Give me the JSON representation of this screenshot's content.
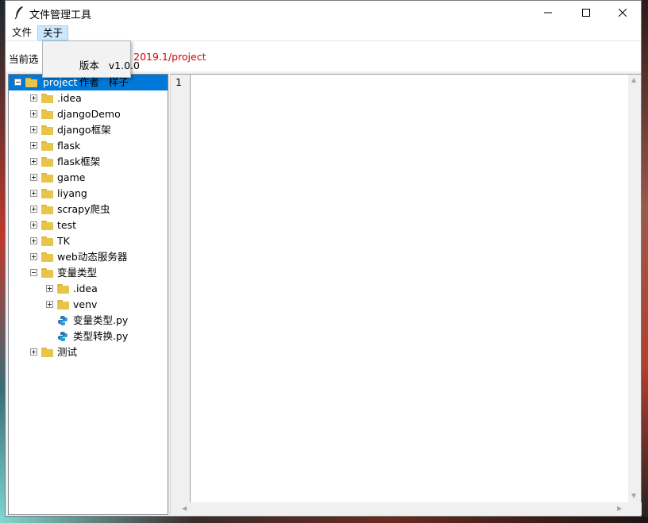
{
  "window": {
    "title": "文件管理工具",
    "icon": "feather-icon"
  },
  "menubar": {
    "items": [
      {
        "label": "文件"
      },
      {
        "label": "关于"
      }
    ]
  },
  "about_menu": {
    "rows": [
      {
        "label": "版本",
        "value": "v1.0.0"
      },
      {
        "label": "作者",
        "value": "样子"
      }
    ]
  },
  "path": {
    "label": "当前选",
    "value": "m 2019.1/project",
    "value_color": "#d00000"
  },
  "tree": {
    "nodes": [
      {
        "label": "project",
        "type": "folder",
        "expander": "minus",
        "level": 0,
        "selected": true
      },
      {
        "label": ".idea",
        "type": "folder",
        "expander": "plus",
        "level": 1
      },
      {
        "label": "djangoDemo",
        "type": "folder",
        "expander": "plus",
        "level": 1
      },
      {
        "label": "django框架",
        "type": "folder",
        "expander": "plus",
        "level": 1
      },
      {
        "label": "flask",
        "type": "folder",
        "expander": "plus",
        "level": 1
      },
      {
        "label": "flask框架",
        "type": "folder",
        "expander": "plus",
        "level": 1
      },
      {
        "label": "game",
        "type": "folder",
        "expander": "plus",
        "level": 1
      },
      {
        "label": "liyang",
        "type": "folder",
        "expander": "plus",
        "level": 1
      },
      {
        "label": "scrapy爬虫",
        "type": "folder",
        "expander": "plus",
        "level": 1
      },
      {
        "label": "test",
        "type": "folder",
        "expander": "plus",
        "level": 1
      },
      {
        "label": "TK",
        "type": "folder",
        "expander": "plus",
        "level": 1
      },
      {
        "label": "web动态服务器",
        "type": "folder",
        "expander": "plus",
        "level": 1
      },
      {
        "label": "变量类型",
        "type": "folder",
        "expander": "minus",
        "level": 1
      },
      {
        "label": ".idea",
        "type": "folder",
        "expander": "plus",
        "level": 2
      },
      {
        "label": "venv",
        "type": "folder",
        "expander": "plus",
        "level": 2
      },
      {
        "label": "变量类型.py",
        "type": "python",
        "expander": "none",
        "level": 2
      },
      {
        "label": "类型转换.py",
        "type": "python",
        "expander": "none",
        "level": 2
      },
      {
        "label": "测试",
        "type": "folder",
        "expander": "plus",
        "level": 1
      }
    ]
  },
  "editor": {
    "line_numbers": [
      "1"
    ],
    "content": ""
  },
  "colors": {
    "selection": "#0078d7",
    "folder": "#e8c44a",
    "path_text": "#d00000"
  }
}
